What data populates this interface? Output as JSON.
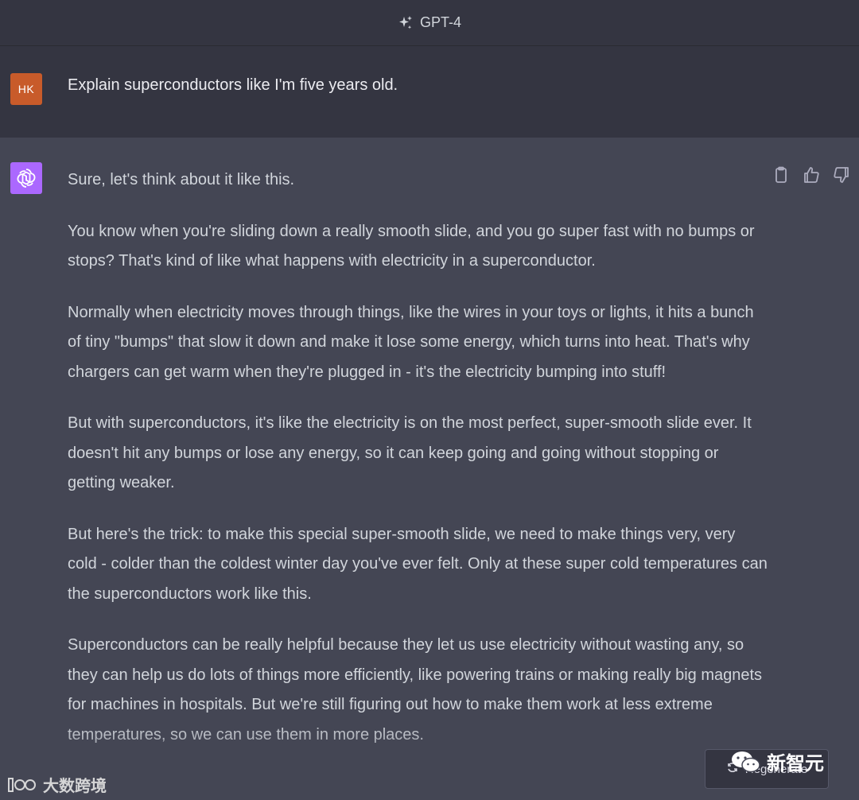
{
  "header": {
    "model_label": "GPT-4",
    "icon": "sparkle-icon"
  },
  "user_message": {
    "avatar_initials": "HK",
    "avatar_color": "#c85b2a",
    "text": "Explain superconductors like I'm five years old."
  },
  "assistant_message": {
    "avatar_icon": "openai-logo-icon",
    "avatar_color": "#ab68ff",
    "paragraphs": [
      "Sure, let's think about it like this.",
      "You know when you're sliding down a really smooth slide, and you go super fast with no bumps or stops? That's kind of like what happens with electricity in a superconductor.",
      "Normally when electricity moves through things, like the wires in your toys or lights, it hits a bunch of tiny \"bumps\" that slow it down and make it lose some energy, which turns into heat. That's why chargers can get warm when they're plugged in - it's the electricity bumping into stuff!",
      "But with superconductors, it's like the electricity is on the most perfect, super-smooth slide ever. It doesn't hit any bumps or lose any energy, so it can keep going and going without stopping or getting weaker.",
      "But here's the trick: to make this special super-smooth slide, we need to make things very, very cold - colder than the coldest winter day you've ever felt. Only at these super cold temperatures can the superconductors work like this.",
      "Superconductors can be really helpful because they let us use electricity without wasting any, so they can help us do lots of things more efficiently, like powering trains or making really big magnets for machines in hospitals. But we're still figuring out how to make them work at less extreme temperatures, so we can use them in more places."
    ],
    "actions": [
      "copy-icon",
      "thumbs-up-icon",
      "thumbs-down-icon"
    ]
  },
  "regenerate_button": {
    "label": "Regenerate",
    "icon": "refresh-icon"
  },
  "watermarks": {
    "left": "大数跨境",
    "right": "新智元"
  },
  "colors": {
    "header_bg": "#343541",
    "answer_bg": "#444654",
    "text": "#d1d5db"
  }
}
